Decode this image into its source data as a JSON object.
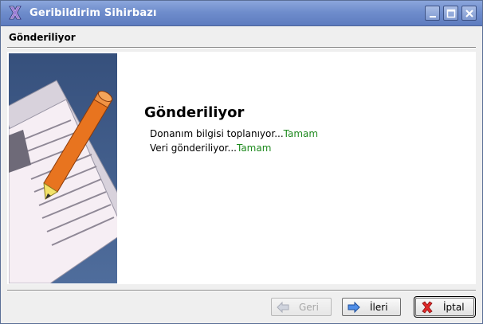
{
  "window": {
    "title": "Geribildirim Sihirbazı"
  },
  "header": {
    "title": "Gönderiliyor"
  },
  "main": {
    "heading": "Gönderiliyor",
    "lines": [
      {
        "text": "Donanım bilgisi toplanıyor...",
        "status": "Tamam"
      },
      {
        "text": "Veri gönderiliyor...",
        "status": "Tamam"
      }
    ]
  },
  "buttons": {
    "back": "Geri",
    "next": "İleri",
    "cancel": "İptal"
  },
  "colors": {
    "titlebar": "#6f8dcc",
    "status_ok": "#1e8a1e",
    "art_background": "#3e5a86",
    "pencil": "#e86e1c"
  },
  "icons": {
    "app": "app-x-icon",
    "minimize": "minimize-icon",
    "maximize": "maximize-icon",
    "close": "close-icon",
    "back": "arrow-left-icon",
    "next": "arrow-right-icon",
    "cancel": "red-x-icon"
  }
}
